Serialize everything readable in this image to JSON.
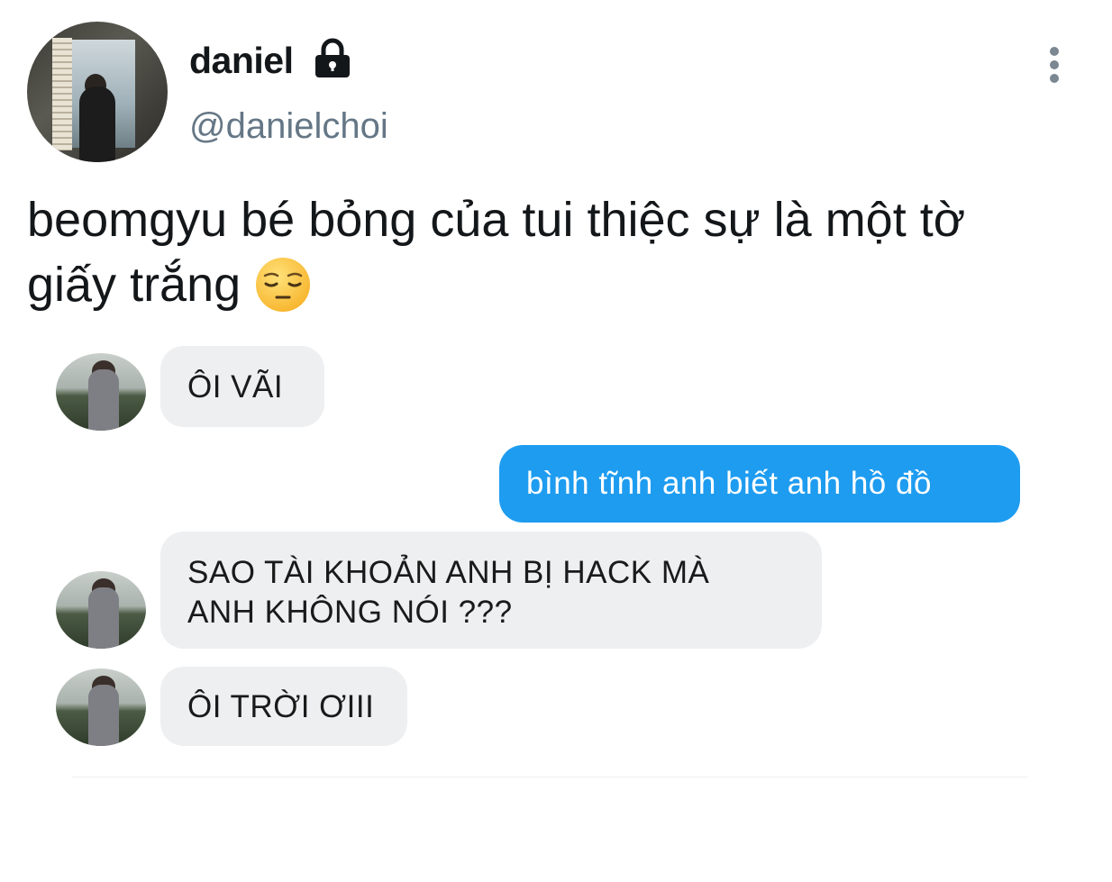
{
  "author": {
    "display_name": "daniel",
    "handle": "@danielchoi",
    "protected_icon": "lock-icon"
  },
  "menu_icon": "more-vertical-icon",
  "tweet": {
    "text_line1": "beomgyu bé bỏng của tui thiệc sự là một tờ",
    "text_line2": "giấy trắng",
    "emoji": "pensive-face-emoji"
  },
  "chat": {
    "messages": [
      {
        "direction": "incoming",
        "text": "ÔI VÃI"
      },
      {
        "direction": "outgoing",
        "text": "bình tĩnh anh biết anh hồ đồ"
      },
      {
        "direction": "incoming",
        "lines": [
          "SAO TÀI KHOẢN ANH BỊ HACK MÀ",
          "ANH KHÔNG NÓI ???"
        ]
      },
      {
        "direction": "incoming",
        "text": "ÔI TRỜI ƠIII"
      }
    ]
  },
  "colors": {
    "outgoing_bubble": "#1e9cf0",
    "incoming_bubble": "#eeeff1",
    "handle_gray": "#657786"
  }
}
